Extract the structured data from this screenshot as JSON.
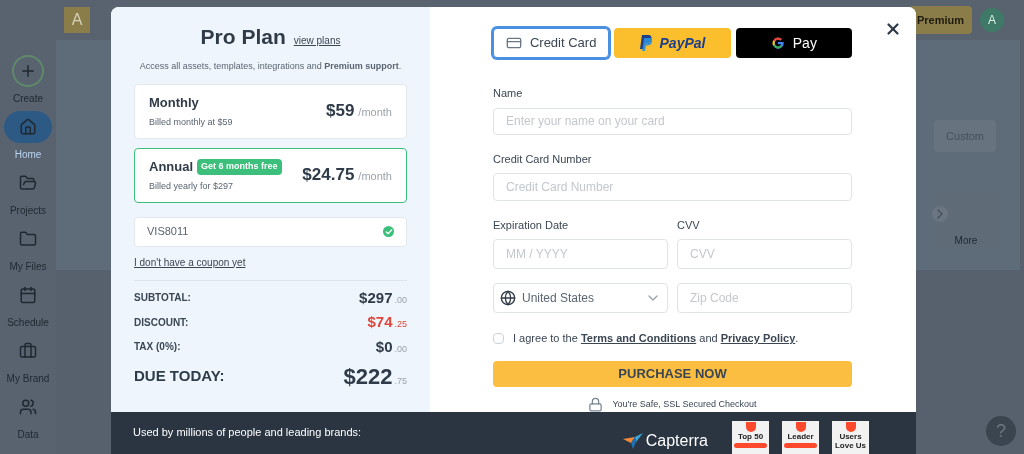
{
  "backdrop": {
    "account_initial": "A",
    "premium_button": "Premium",
    "user_initial": "A",
    "sidebar": [
      {
        "label": "Create",
        "kind": "create",
        "selected": false
      },
      {
        "label": "Home",
        "kind": "home",
        "selected": true
      },
      {
        "label": "Projects",
        "kind": "projects",
        "selected": false
      },
      {
        "label": "My Files",
        "kind": "files",
        "selected": false
      },
      {
        "label": "Schedule",
        "kind": "schedule",
        "selected": false
      },
      {
        "label": "My Brand",
        "kind": "brand",
        "selected": false
      },
      {
        "label": "Data",
        "kind": "data",
        "selected": false
      }
    ],
    "custom_button": "Custom",
    "more_tile": "More",
    "help_button": "?"
  },
  "plan": {
    "title": "Pro Plan",
    "view_plans": "view plans",
    "description": "Access all assets, templates, integrations and **Premium support**.",
    "options": [
      {
        "name": "Monthly",
        "billing": "Billed monthly at $59",
        "price": "$59",
        "period": "/month",
        "selected": false
      },
      {
        "name": "Annual",
        "badge": "Get 6 months free",
        "billing": "Billed yearly for $297",
        "price": "$24.75",
        "period": "/month",
        "selected": true
      }
    ],
    "coupon": {
      "value": "VIS8011",
      "valid": true
    },
    "no_coupon_link": "I don't have a coupon yet",
    "summary": [
      {
        "label": "SUBTOTAL:",
        "amount": "$297",
        "cents": ".00",
        "kind": "normal"
      },
      {
        "label": "DISCOUNT:",
        "amount": "$74",
        "cents": ".25",
        "kind": "discount"
      },
      {
        "label": "TAX (0%):",
        "amount": "$0",
        "cents": ".00",
        "kind": "normal"
      },
      {
        "label": "DUE TODAY:",
        "amount": "$222",
        "cents": ".75",
        "kind": "total"
      }
    ]
  },
  "payment_methods": [
    {
      "label": "Credit Card",
      "kind": "card",
      "selected": true
    },
    {
      "label": "PayPal",
      "kind": "paypal",
      "selected": false
    },
    {
      "label": "Pay",
      "kind": "gpay",
      "selected": false
    }
  ],
  "form": {
    "name": {
      "label": "Name",
      "placeholder": "Enter your name on your card"
    },
    "card_number": {
      "label": "Credit Card Number",
      "placeholder": "Credit Card Number"
    },
    "expiration": {
      "label": "Expiration Date",
      "placeholder": "MM / YYYY"
    },
    "cvv": {
      "label": "CVV",
      "placeholder": "CVV"
    },
    "country": {
      "value": "United States"
    },
    "zip": {
      "placeholder": "Zip Code"
    }
  },
  "terms": {
    "checked": false,
    "prefix": "I agree to the",
    "links": [
      "Terms and Conditions",
      "Privacy Policy"
    ],
    "joiner": "and",
    "suffix": "."
  },
  "purchase_button": "PURCHASE NOW",
  "secure_note": "You're Safe, SSL Secured Checkout",
  "footer": {
    "text": "Used by millions of people and leading brands:",
    "capterra": "Capterra",
    "badges": [
      {
        "title": "Top 50",
        "ribbon": true
      },
      {
        "title": "Leader",
        "ribbon": true
      },
      {
        "title": "Users Love Us",
        "ribbon": false
      }
    ]
  }
}
